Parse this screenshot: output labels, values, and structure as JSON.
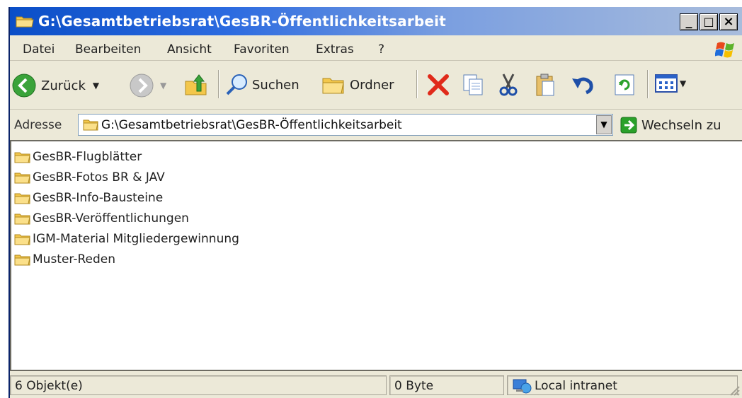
{
  "window": {
    "title": "G:\\Gesamtbetriebsrat\\GesBR-Öffentlichkeitsarbeit",
    "minimize_label": "_",
    "maximize_label": "□",
    "close_label": "×"
  },
  "menu": {
    "items": [
      "Datei",
      "Bearbeiten",
      "Ansicht",
      "Favoriten",
      "Extras",
      "?"
    ]
  },
  "toolbar": {
    "back_label": "Zurück",
    "search_label": "Suchen",
    "folders_label": "Ordner"
  },
  "address": {
    "label": "Adresse",
    "value": "G:\\Gesamtbetriebsrat\\GesBR-Öffentlichkeitsarbeit",
    "go_label": "Wechseln zu"
  },
  "files": [
    {
      "name": "GesBR-Flugblätter",
      "icon": "folder-icon"
    },
    {
      "name": "GesBR-Fotos BR & JAV",
      "icon": "folder-icon"
    },
    {
      "name": "GesBR-Info-Bausteine",
      "icon": "folder-icon"
    },
    {
      "name": "GesBR-Veröffentlichungen",
      "icon": "folder-icon"
    },
    {
      "name": "IGM-Material Mitgliedergewinnung",
      "icon": "folder-icon"
    },
    {
      "name": "Muster-Reden",
      "icon": "folder-icon"
    }
  ],
  "status": {
    "objects": "6 Objekt(e)",
    "size": "0 Byte",
    "zone": "Local intranet"
  },
  "colors": {
    "title_bar": "#0a4ec7",
    "face": "#ece9d8",
    "folder": "#f3c74b"
  }
}
